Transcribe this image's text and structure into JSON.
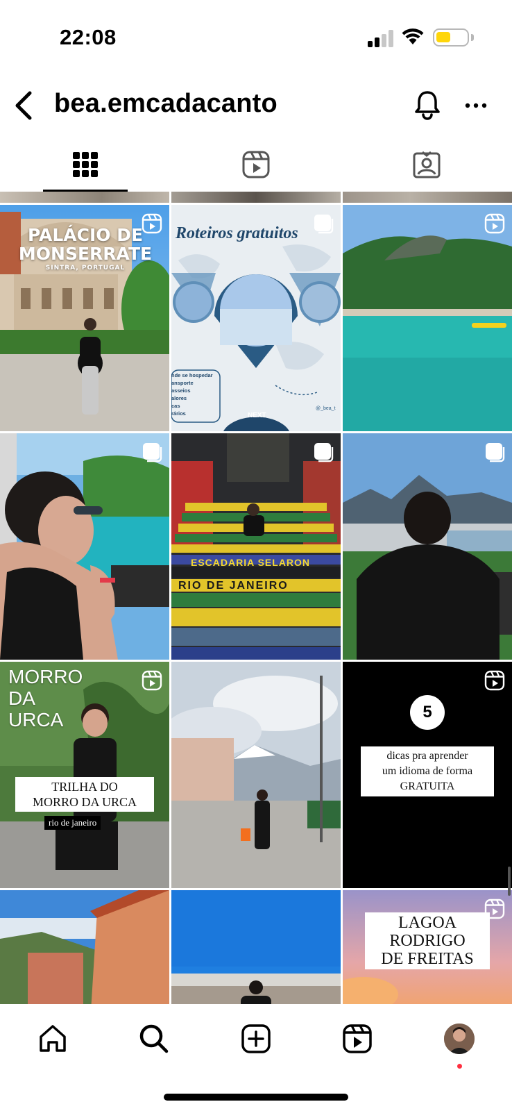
{
  "status_bar": {
    "time": "22:08",
    "signal_icon": "cellular-signal-icon",
    "wifi_icon": "wifi-icon",
    "battery_icon": "battery-icon",
    "battery_level": 0.4,
    "battery_color": "#ffd60a"
  },
  "header": {
    "username": "bea.emcadacanto",
    "back_icon": "back-chevron-icon",
    "bell_icon": "bell-icon",
    "more_icon": "more-dots-icon"
  },
  "tabs": [
    {
      "icon": "grid-icon",
      "active": true
    },
    {
      "icon": "reels-icon",
      "active": false
    },
    {
      "icon": "tagged-icon",
      "active": false
    }
  ],
  "posts": {
    "monserrate": {
      "title_line1": "PALÁCIO DE",
      "title_line2": "MONSERRATE",
      "subtitle": "SINTRA, PORTUGAL",
      "type_icon": "reel-icon"
    },
    "roteiros": {
      "title": "Roteiros gratuitos",
      "list": [
        "nde se hospedar",
        "ansporte",
        "asseios",
        "alores",
        "cas",
        "rários"
      ],
      "next_label": "NEXT",
      "handle": "@_bea_t",
      "type_icon": "carousel-icon"
    },
    "lagoa_azul": {
      "type_icon": "reel-icon"
    },
    "boat": {
      "type_icon": "carousel-icon"
    },
    "selaron": {
      "sign1": "ESCADARIA SELARON",
      "sign2": "RIO DE JANEIRO",
      "type_icon": "carousel-icon"
    },
    "cristo_view": {
      "type_icon": "carousel-icon"
    },
    "urca": {
      "sign_line1": "MORRO",
      "sign_line2": "DA",
      "sign_line3": "URCA",
      "caption_line1": "TRILHA DO",
      "caption_line2": "MORRO DA URCA",
      "caption_sub": "rio de janeiro",
      "type_icon": "reel-icon"
    },
    "alps": {},
    "dicas": {
      "number": "5",
      "line1": "dicas pra aprender",
      "line2": "um idioma de forma",
      "line3": "GRATUITA",
      "type_icon": "reel-icon"
    },
    "lagoa": {
      "line1": "LAGOA",
      "line2": "RODRIGO",
      "line3": "DE FREITAS",
      "type_icon": "reel-icon"
    }
  },
  "bottom_nav": [
    {
      "icon": "home-icon"
    },
    {
      "icon": "search-icon"
    },
    {
      "icon": "create-post-icon"
    },
    {
      "icon": "reels-icon"
    },
    {
      "icon": "profile-avatar"
    }
  ],
  "colors": {
    "accent_notification": "#ff2f40",
    "battery": "#ffd60a"
  }
}
